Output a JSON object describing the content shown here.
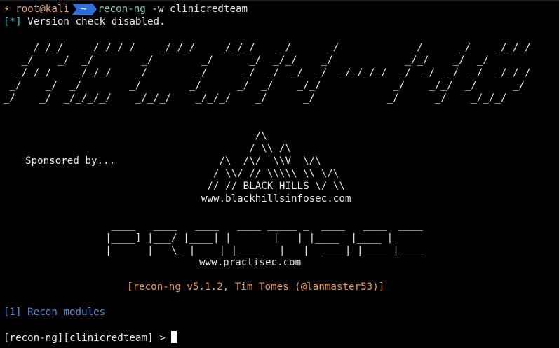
{
  "prompt": {
    "bolt": "⚡",
    "user_host": "root@kali",
    "dir": "~",
    "command": "recon-ng",
    "args": "-w clinicredteam"
  },
  "status": {
    "marker": "[*]",
    "text": "Version check disabled."
  },
  "banner": {
    "logo_lines": [
      "    _/_/_/    _/_/_/_/    _/_/_/    _/_/_/    _/      _/            _/      _/    _/_/_/",
      "   _/    _/  _/        _/        _/      _/  _/_/    _/            _/_/    _/  _/",
      "  _/_/_/    _/_/_/    _/        _/      _/  _/  _/  _/  _/_/_/_/  _/  _/  _/  _/  _/_/_/",
      " _/    _/  _/        _/        _/      _/  _/    _/_/            _/    _/_/  _/      _/",
      "_/    _/  _/_/_/_/    _/_/_/    _/_/_/    _/      _/            _/      _/    _/_/_/"
    ],
    "bh_art": [
      "                                          /\\",
      "                                         / \\\\ /\\",
      "                                    /\\  /\\/  \\\\V  \\/\\",
      "                                   / \\\\/ // \\\\\\\\\\ \\\\ \\/\\",
      "                                  // // BLACK HILLS \\/ \\\\",
      "                                 www.blackhillsinfosec.com"
    ],
    "sponsor_text": "Sponsored by...",
    "practisec_art": [
      "                  ____   ____   ____   ____ _____ _  ____   ____  ____",
      "                 |____] |___/ |____| |       |   | |____  |____ |",
      "                 |      |   \\_ |    | |____   |   |  ____| |____ |____"
    ],
    "practisec_url": "www.practisec.com",
    "version_line": "[recon-ng v5.1.2, Tim Tomes (@lanmaster53)]"
  },
  "modules": {
    "count_label": "[1]",
    "label": "Recon modules"
  },
  "shell_prompt": {
    "text": "[recon-ng][clinicredteam] >"
  },
  "colors": {
    "background": "#000000",
    "chip": "#2f6fd9",
    "version": "#ef9c3e",
    "modules": "#4e90e0",
    "marker": "#3bb8c8"
  }
}
